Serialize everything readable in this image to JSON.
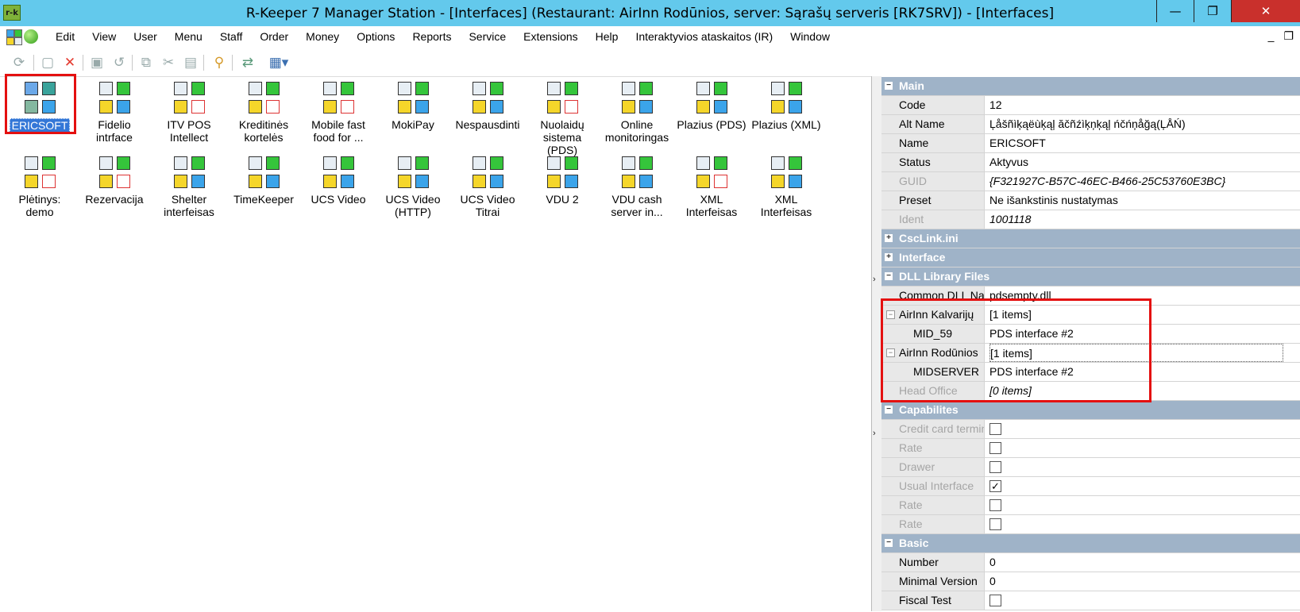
{
  "titlebar": {
    "logo_text": "r-k",
    "title": "R-Keeper 7 Manager Station - [Interfaces] (Restaurant: AirInn Rodūnios, server: Sąrašų serveris [RK7SRV]) - [Interfaces]",
    "minimize": "—",
    "restore": "❐",
    "close": "✕"
  },
  "menu": {
    "items": [
      "Edit",
      "View",
      "User",
      "Menu",
      "Staff",
      "Order",
      "Money",
      "Options",
      "Reports",
      "Service",
      "Extensions",
      "Help",
      "Interaktyvios ataskaitos (IR)",
      "Window"
    ],
    "right_min": "_",
    "right_restore": "❐"
  },
  "toolbar": {
    "icons": [
      "refresh-icon",
      "new-document-icon",
      "delete-icon",
      "save-icon",
      "undo-icon",
      "copy-icon",
      "cut-icon",
      "paste-icon",
      "search-icon",
      "transfer-icon",
      "view-mode-icon"
    ]
  },
  "interfaces": [
    {
      "label": "ERICSOFT",
      "selected": true
    },
    {
      "label": "Fidelio intrface"
    },
    {
      "label": "ITV POS Intellect"
    },
    {
      "label": "Kreditinės kortelės"
    },
    {
      "label": "Mobile fast food for ..."
    },
    {
      "label": "MokiPay"
    },
    {
      "label": "Nespausdinti"
    },
    {
      "label": "Nuolaidų sistema (PDS)"
    },
    {
      "label": "Online monitoringas"
    },
    {
      "label": "Plazius (PDS)"
    },
    {
      "label": "Plazius (XML)"
    },
    {
      "label": "Plėtinys: demo"
    },
    {
      "label": "Rezervacija"
    },
    {
      "label": "Shelter interfeisas"
    },
    {
      "label": "TimeKeeper"
    },
    {
      "label": "UCS Video"
    },
    {
      "label": "UCS Video (HTTP)"
    },
    {
      "label": "UCS Video Titrai"
    },
    {
      "label": "VDU 2"
    },
    {
      "label": "VDU cash server in..."
    },
    {
      "label": "XML Interfeisas"
    },
    {
      "label": "XML Interfeisas"
    }
  ],
  "props": {
    "main_section": "Main",
    "code_label": "Code",
    "code_value": "12",
    "altname_label": "Alt Name",
    "altname_value": "Ļåšñìķąëùķąļ ăčñźìķņķąļ ńčńņåğą(ĻÅŃ)",
    "name_label": "Name",
    "name_value": "ERICSOFT",
    "status_label": "Status",
    "status_value": "Aktyvus",
    "guid_label": "GUID",
    "guid_value": "{F321927C-B57C-46EC-B466-25C53760E3BC}",
    "preset_label": "Preset",
    "preset_value": "Ne išankstinis nustatymas",
    "ident_label": "Ident",
    "ident_value": "1001118",
    "csclink_section": "CscLink.ini",
    "interface_section": "Interface",
    "dll_section": "DLL Library Files",
    "commondll_label": "Common DLL Nar",
    "commondll_value": "pdsempty.dll",
    "kalvariju_label": "AirInn Kalvarijų",
    "kalvariju_value": "[1 items]",
    "mid59_label": "MID_59",
    "mid59_value": "PDS interface #2",
    "rodunios_label": "AirInn Rodūnios",
    "rodunios_value": "[1 items]",
    "midserver_label": "MIDSERVER",
    "midserver_value": "PDS interface #2",
    "headoffice_label": "Head Office",
    "headoffice_value": "[0 items]",
    "capabilities_section": "Capabilites",
    "creditcard_label": "Credit card termin",
    "rate1_label": "Rate",
    "drawer_label": "Drawer",
    "usual_label": "Usual Interface",
    "usual_checked": "✓",
    "rate2_label": "Rate",
    "rate3_label": "Rate",
    "basic_section": "Basic",
    "number_label": "Number",
    "number_value": "0",
    "minver_label": "Minimal Version",
    "minver_value": "0",
    "fiscal_label": "Fiscal Test"
  },
  "colors": {
    "titlebar": "#63c9ec",
    "section_header": "#9fb3c8",
    "highlight": "#e41010",
    "selection": "#3377d7"
  }
}
